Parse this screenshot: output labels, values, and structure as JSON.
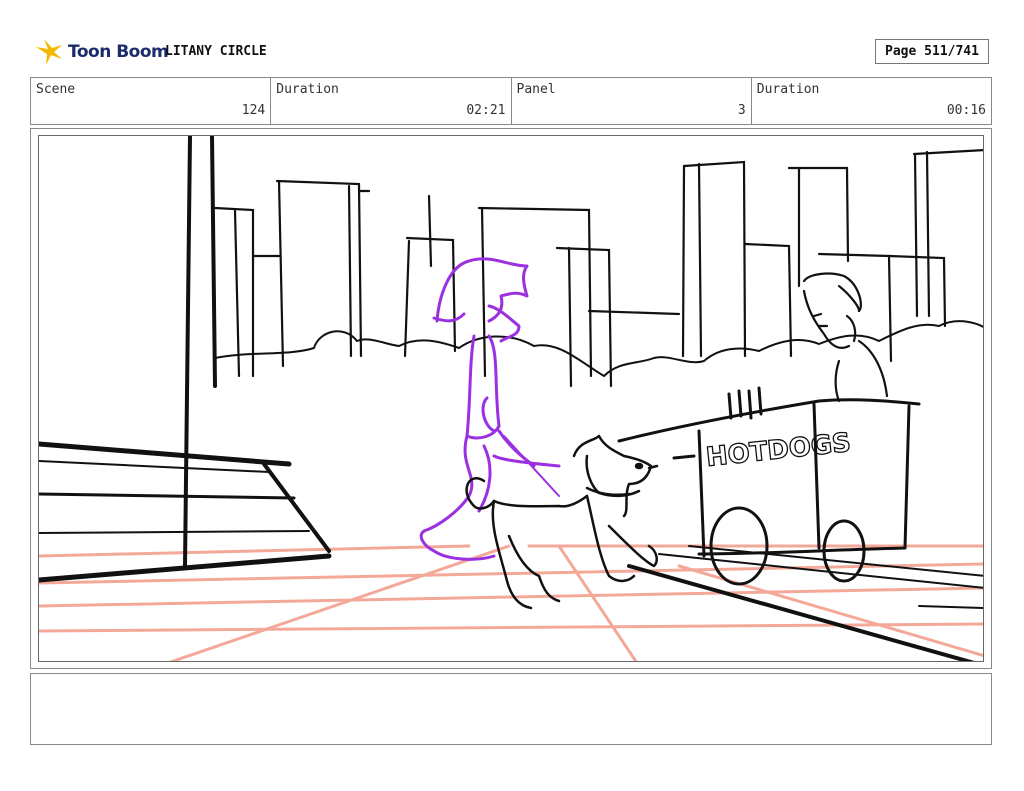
{
  "header": {
    "logo_text": "Toon Boom",
    "project_title": "LITANY CIRCLE",
    "page": "Page 511/741"
  },
  "info": {
    "scene_label": "Scene",
    "scene_value": "124",
    "duration_label": "Duration",
    "duration_value": "02:21",
    "panel_label": "Panel",
    "panel_value": "3",
    "panel_duration_label": "Duration",
    "panel_duration_value": "00:16"
  },
  "panel": {
    "cart_sign": "HOTDOGS"
  },
  "colors": {
    "character_stroke": "#9b30e0",
    "floor_stroke": "#f4a898",
    "ink": "#111111",
    "logo_accent": "#f5b800"
  },
  "notes": {
    "text": ""
  }
}
